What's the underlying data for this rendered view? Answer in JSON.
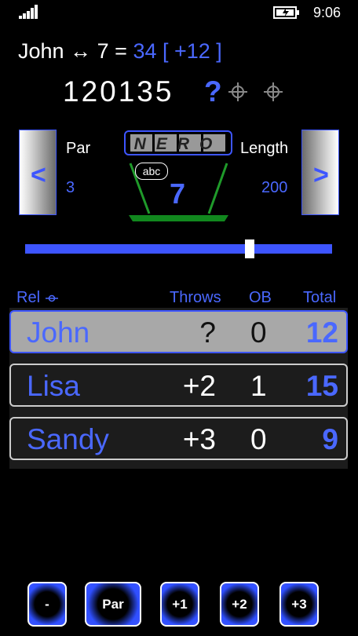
{
  "status_bar": {
    "time": "9:06",
    "signal_icon": "signal-icon",
    "battery_icon": "battery-charging-icon"
  },
  "header": {
    "player": "John",
    "arrow": "↔",
    "hole": "7",
    "equals": "=",
    "score": "34",
    "delta": "[ +12 ]",
    "scores_row": "120135",
    "unknown": "?"
  },
  "hole_panel": {
    "prev_label": "<",
    "next_label": ">",
    "par_label": "Par",
    "par_value": "3",
    "length_label": "Length",
    "length_value": "200",
    "logo_text": "NERO",
    "badge": "abc",
    "hole_number": "7"
  },
  "slider": {
    "value_fraction": 0.74
  },
  "table": {
    "headers": {
      "rel": "Rel",
      "throws": "Throws",
      "ob": "OB",
      "total": "Total"
    },
    "rows": [
      {
        "name": "John",
        "throws": "?",
        "ob": "0",
        "total": "12",
        "selected": true
      },
      {
        "name": "Lisa",
        "throws": "+2",
        "ob": "1",
        "total": "15",
        "selected": false
      },
      {
        "name": "Sandy",
        "throws": "+3",
        "ob": "0",
        "total": "9",
        "selected": false
      }
    ]
  },
  "buttons": {
    "minus": "-",
    "par": "Par",
    "plus1": "+1",
    "plus2": "+2",
    "plus3": "+3"
  },
  "colors": {
    "accent": "#3d55ff",
    "selected_row": "#a8a8a8",
    "background": "#000000"
  }
}
